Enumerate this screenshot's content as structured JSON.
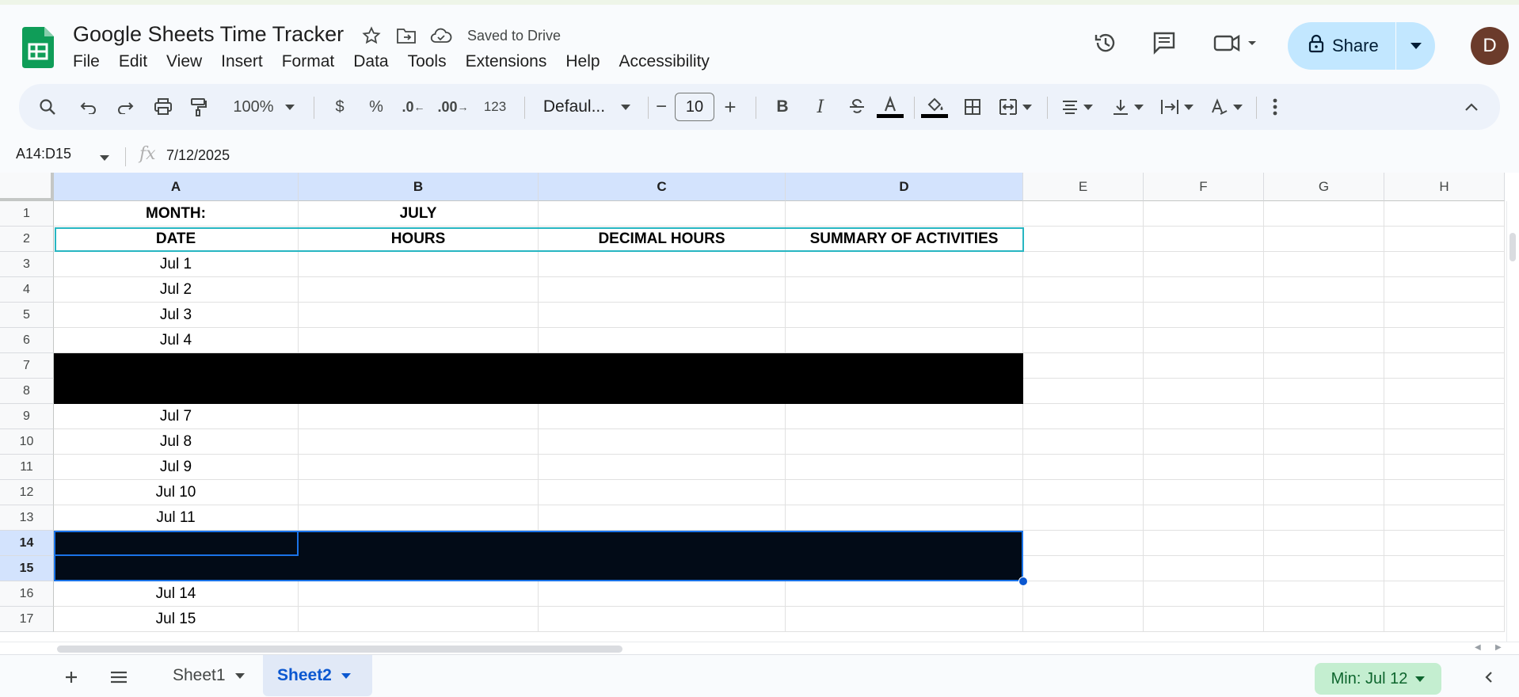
{
  "app": {
    "title": "Google Sheets Time Tracker",
    "saved_status": "Saved to Drive",
    "avatar_initial": "D",
    "share_label": "Share"
  },
  "menu": [
    "File",
    "Edit",
    "View",
    "Insert",
    "Format",
    "Data",
    "Tools",
    "Extensions",
    "Help",
    "Accessibility"
  ],
  "toolbar": {
    "zoom": "100%",
    "currency": "$",
    "percent": "%",
    "dec_decrease": ".0",
    "dec_increase": ".00",
    "number_format": "123",
    "font": "Defaul...",
    "font_size": "10",
    "minus": "−",
    "plus": "+",
    "bold": "B",
    "italic": "I"
  },
  "formula_bar": {
    "name_box": "A14:D15",
    "fx": "fx",
    "value": "7/12/2025"
  },
  "columns": [
    "A",
    "B",
    "C",
    "D",
    "E",
    "F",
    "G",
    "H"
  ],
  "rows": [
    "1",
    "2",
    "3",
    "4",
    "5",
    "6",
    "7",
    "8",
    "9",
    "10",
    "11",
    "12",
    "13",
    "14",
    "15",
    "16",
    "17"
  ],
  "cells": {
    "A1": "MONTH:",
    "B1": "JULY",
    "A2": "DATE",
    "B2": "HOURS",
    "C2": "DECIMAL HOURS",
    "D2": "SUMMARY OF ACTIVITIES",
    "A3": "Jul 1",
    "A4": "Jul 2",
    "A5": "Jul 3",
    "A6": "Jul 4",
    "A9": "Jul 7",
    "A10": "Jul 8",
    "A11": "Jul 9",
    "A12": "Jul 10",
    "A13": "Jul 11",
    "A16": "Jul 14",
    "A17": "Jul 15"
  },
  "sheets": [
    {
      "name": "Sheet1",
      "active": false
    },
    {
      "name": "Sheet2",
      "active": true
    }
  ],
  "explore": "Min: Jul 12",
  "colors": {
    "accent": "#0b57d0",
    "share_bg": "#c2e7ff",
    "selection": "#1a73e8",
    "explore_bg": "#c4eed0"
  }
}
